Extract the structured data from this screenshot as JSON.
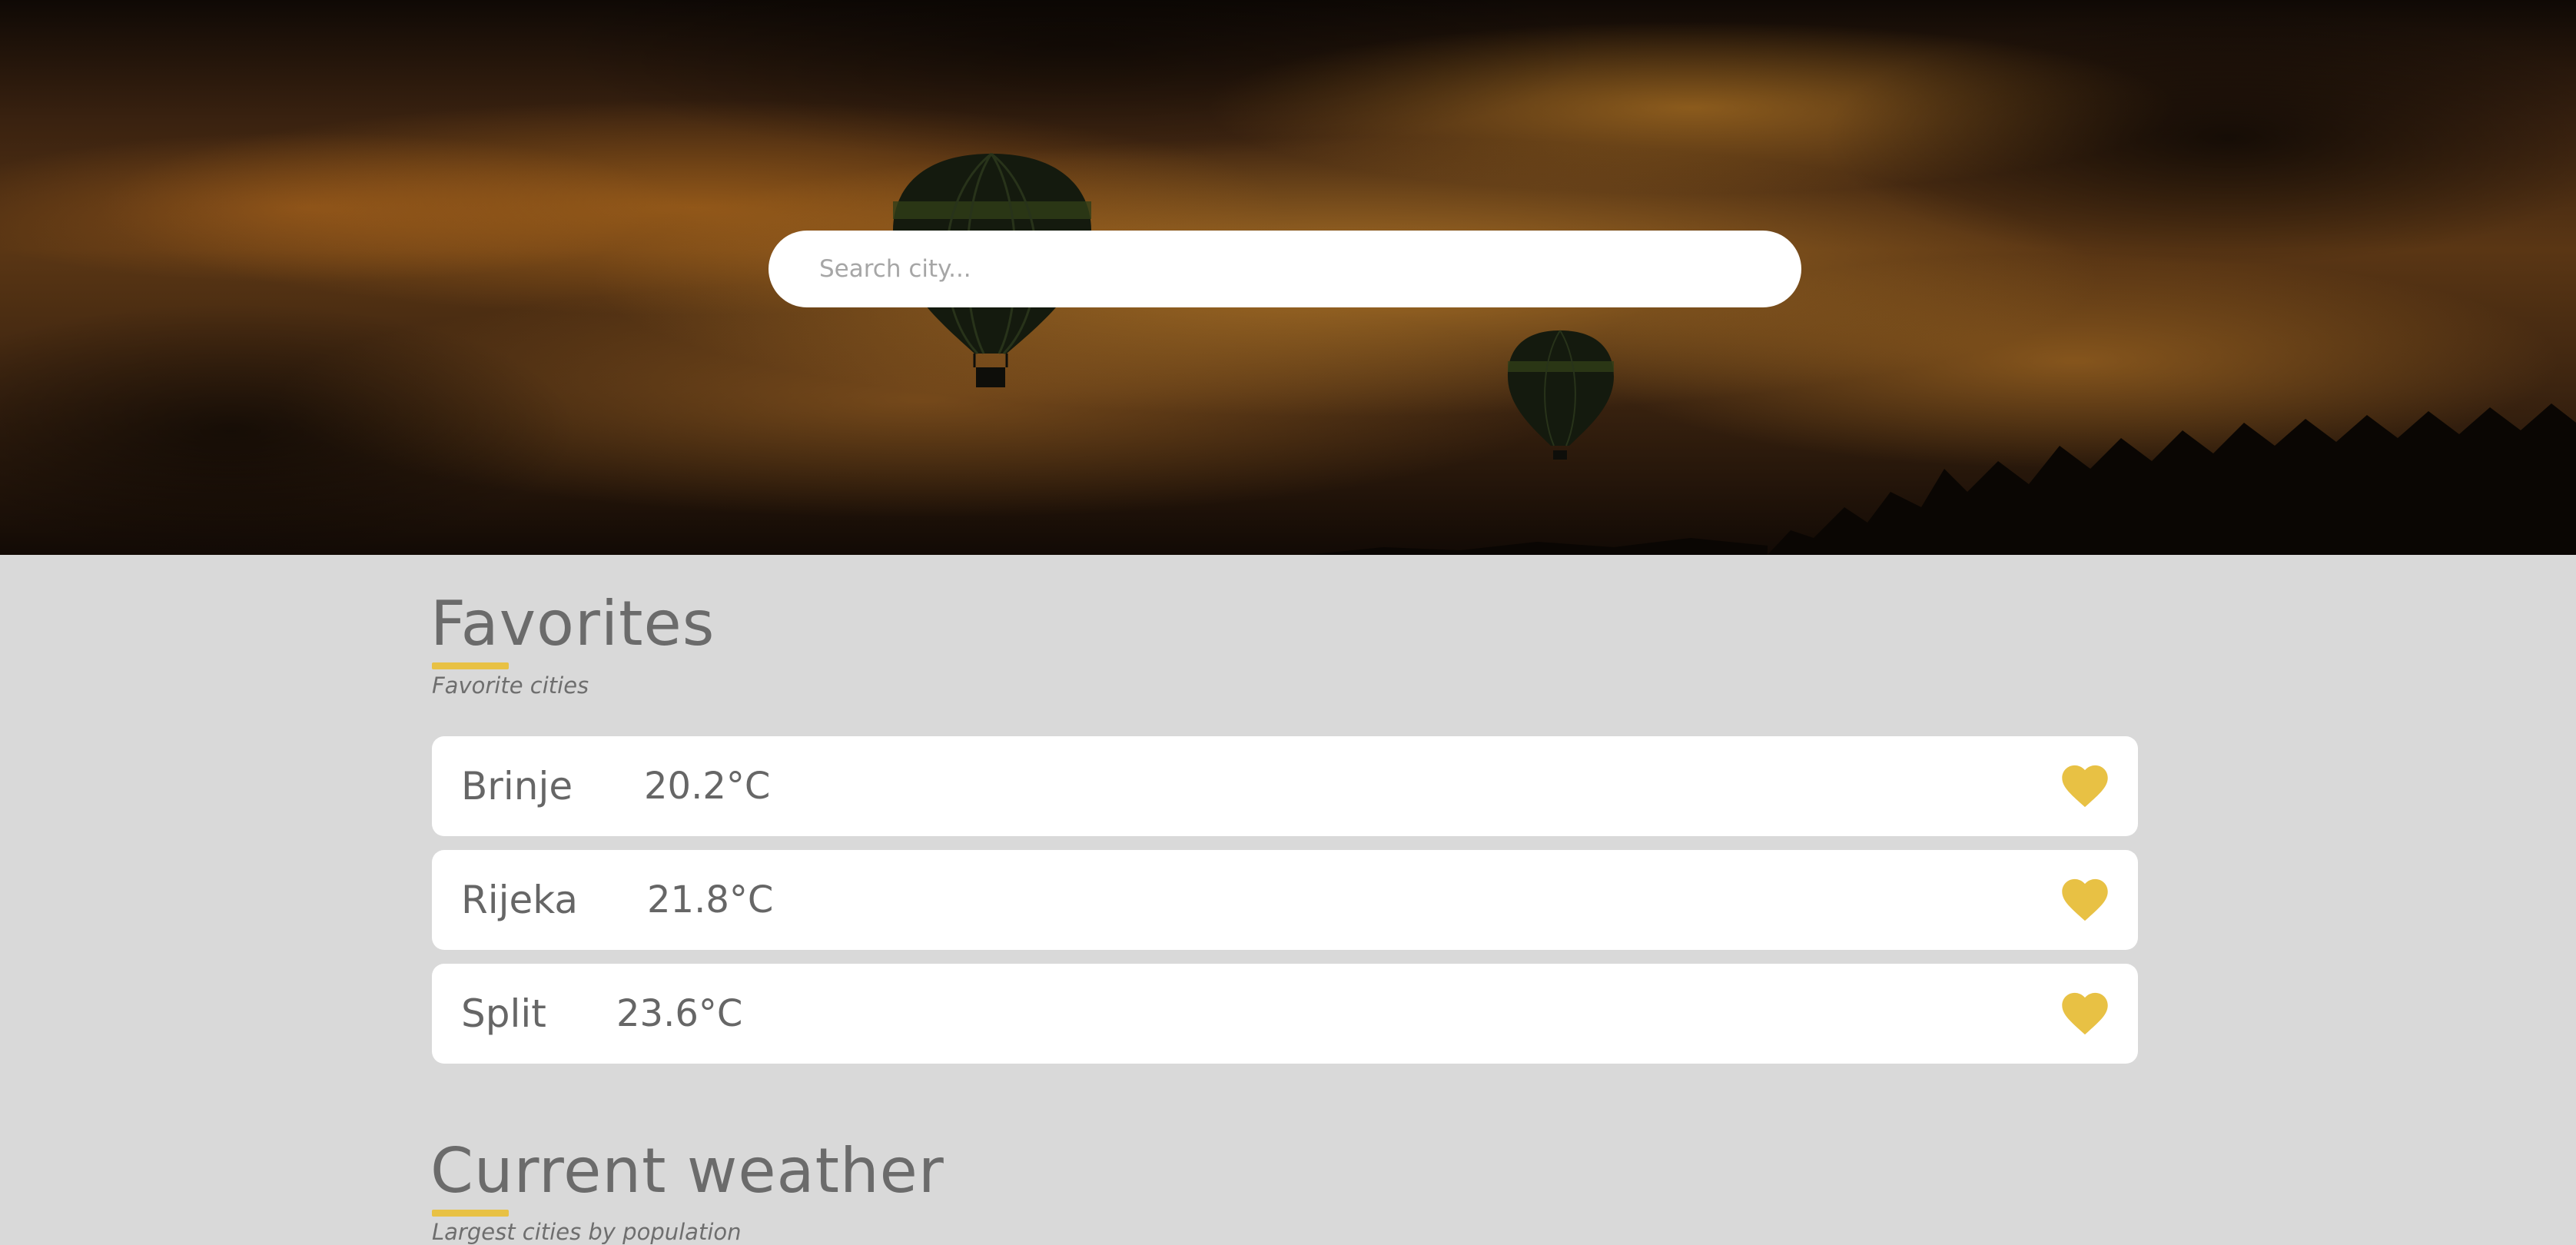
{
  "search": {
    "placeholder": "Search city..."
  },
  "favorites": {
    "title": "Favorites",
    "subtitle": "Favorite cities",
    "items": [
      {
        "city": "Brinje",
        "temperature": "20.2°C"
      },
      {
        "city": "Rijeka",
        "temperature": "21.8°C"
      },
      {
        "city": "Split",
        "temperature": "23.6°C"
      }
    ]
  },
  "current_weather": {
    "title": "Current weather",
    "subtitle": "Largest cities by population"
  },
  "icons": {
    "favorite": "heart-icon"
  },
  "colors": {
    "accent": "#e8c144",
    "page_background": "#d9d9d9",
    "card_background": "#ffffff",
    "text": "#666666"
  }
}
